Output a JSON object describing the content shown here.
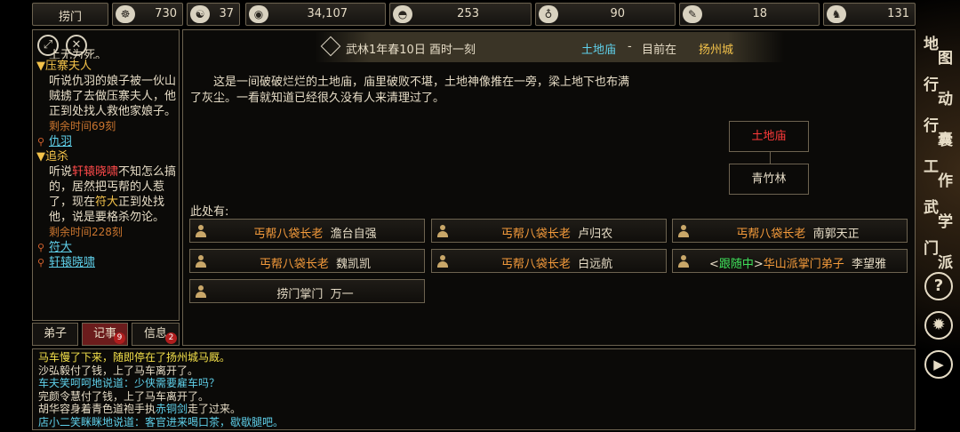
{
  "topbar": {
    "sect": "捞门",
    "stats": [
      {
        "icon": "money-bag-icon",
        "glyph": "☸",
        "value": "730"
      },
      {
        "icon": "yin-yang-icon",
        "glyph": "☯",
        "value": "37"
      },
      {
        "icon": "coin-icon",
        "glyph": "◉",
        "value": "34,107"
      },
      {
        "icon": "food-bowl-icon",
        "glyph": "◓",
        "value": "253"
      },
      {
        "icon": "gourd-icon",
        "glyph": "♁",
        "value": "90"
      },
      {
        "icon": "scroll-icon",
        "glyph": "✎",
        "value": "18"
      },
      {
        "icon": "horse-icon",
        "glyph": "♞",
        "value": "131"
      }
    ]
  },
  "quests": {
    "cutoff_line": "上无为死。",
    "q1_title": "▼压寨夫人",
    "q1_desc": "听说仇羽的娘子被一伙山贼掳了去做压寨夫人，他正到处找人救他家娘子。",
    "q1_time": "剩余时间69刻",
    "q1_link": "仇羽",
    "q2_title": "▼追杀",
    "q2_desc_a": "听说",
    "q2_desc_red": "轩辕晓啸",
    "q2_desc_b": "不知怎么搞的，居然把丐帮的人惹了，现在",
    "q2_desc_hl": "符大",
    "q2_desc_c": "正到处找他，说是要格杀勿论。",
    "q2_time": "剩余时间228刻",
    "q2_link1": "符大",
    "q2_link2": "轩辕晓啸"
  },
  "tabs": {
    "disciples": "弟子",
    "records": "记事",
    "records_badge": "9",
    "messages": "信息",
    "messages_badge": "2"
  },
  "header": {
    "date": "武林1年春10日 酉时一刻",
    "location": "土地庙",
    "separator": "-",
    "current_prefix": "目前在",
    "city": "扬州城"
  },
  "description": "这是一间破破烂烂的土地庙，庙里破败不堪，土地神像推在一旁，梁上地下也布满了灰尘。一看就知道已经很久没有人来清理过了。",
  "map": {
    "current": "土地庙",
    "south": "青竹林"
  },
  "here_label": "此处有:",
  "npcs": [
    {
      "rank": "丐帮八袋长老",
      "name": "澹台自强"
    },
    {
      "rank": "丐帮八袋长老",
      "name": "卢归农"
    },
    {
      "rank": "丐帮八袋长老",
      "name": "南郭天正"
    },
    {
      "rank": "丐帮八袋长老",
      "name": "魏凯凯"
    },
    {
      "rank": "丐帮八袋长老",
      "name": "白远航"
    },
    {
      "follow_open": "<",
      "follow": "跟随中",
      "follow_close": ">",
      "rank": "华山派掌门弟子",
      "name": "李望雅"
    },
    {
      "rank": "",
      "plain": "捞门掌门",
      "name": "万一"
    }
  ],
  "log": [
    {
      "parts": [
        {
          "t": "马车慢了下来，随即停在了扬州城马厩。",
          "c": "c-yel"
        }
      ]
    },
    {
      "parts": [
        {
          "t": "沙弘毅付了钱，上了马车离开了。",
          "c": "c-white"
        }
      ]
    },
    {
      "parts": [
        {
          "t": "车夫笑呵呵地说道：少侠需要雇车吗？",
          "c": "c-cyan"
        }
      ]
    },
    {
      "parts": [
        {
          "t": "完颜令慧付了钱，上了马车离开了。",
          "c": "c-white"
        }
      ]
    },
    {
      "parts": [
        {
          "t": "胡华容身着青色道袍手执",
          "c": "c-white"
        },
        {
          "t": "赤铜剑",
          "c": "c-cyan"
        },
        {
          "t": "走了过来。",
          "c": "c-white"
        }
      ]
    },
    {
      "parts": [
        {
          "t": "店小二笑眯眯地说道：客官进来喝口茶，歇歇腿吧。",
          "c": "c-cyan"
        }
      ]
    }
  ],
  "menu": {
    "map": [
      "地",
      "图"
    ],
    "action": [
      "行",
      "动"
    ],
    "bag": [
      "行",
      "囊"
    ],
    "work": [
      "工",
      "作"
    ],
    "martial": [
      "武",
      "学"
    ],
    "sect": [
      "门",
      "派"
    ],
    "help": "?",
    "settings": "✹",
    "play": "▶"
  },
  "colors": {
    "border": "#6d6350",
    "gold": "#f3c24a",
    "cyan": "#5fd0ea",
    "rank_orange": "#f39a3b",
    "follow_green": "#3fe05a",
    "red": "#ff4a4a"
  }
}
